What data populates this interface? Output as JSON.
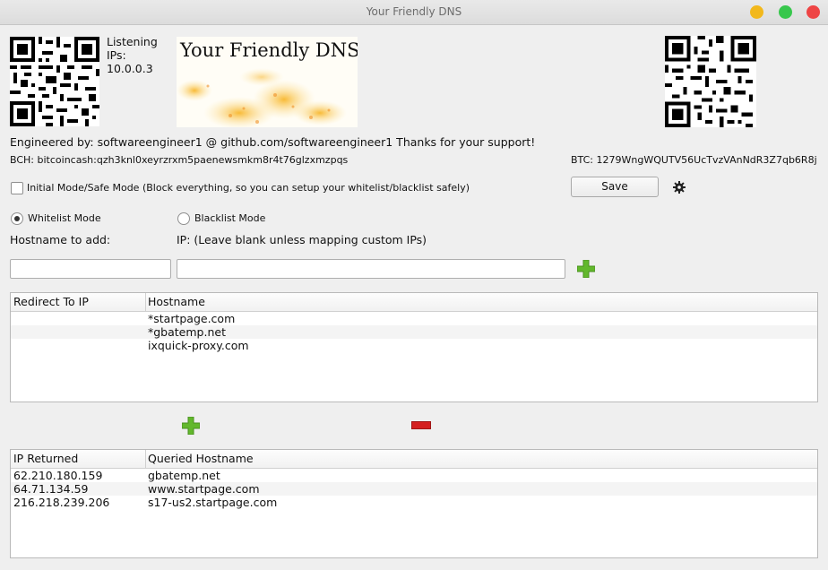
{
  "window": {
    "title": "Your Friendly DNS"
  },
  "listening": {
    "label_line1": "Listening",
    "label_line2": "IPs:",
    "ip": "10.0.0.3"
  },
  "banner": {
    "title": "Your Friendly DNS!"
  },
  "credits": {
    "engineered_by": "Engineered by: softwareengineer1 @ github.com/softwareengineer1 Thanks for your support!",
    "bch": "BCH: bitcoincash:qzh3knl0xeyrzrxm5paenewsmkm8r4t76glzxmzpqs",
    "btc": "BTC: 1279WngWQUTV56UcTvzVAnNdR3Z7qb6R8j"
  },
  "options": {
    "initial_mode_label": "Initial Mode/Safe Mode (Block everything, so you can setup your whitelist/blacklist safely)",
    "initial_mode_checked": false,
    "save_label": "Save",
    "whitelist_label": "Whitelist Mode",
    "blacklist_label": "Blacklist Mode",
    "selected_mode": "whitelist"
  },
  "add_form": {
    "hostname_label": "Hostname to add:",
    "ip_label": "IP: (Leave blank unless mapping custom IPs)",
    "hostname_value": "",
    "ip_value": ""
  },
  "list_table": {
    "columns": [
      "Redirect To IP",
      "Hostname"
    ],
    "rows": [
      [
        "",
        "*startpage.com"
      ],
      [
        "",
        "*gbatemp.net"
      ],
      [
        "",
        "ixquick-proxy.com"
      ]
    ]
  },
  "query_table": {
    "columns": [
      "IP Returned",
      "Queried Hostname"
    ],
    "rows": [
      [
        "62.210.180.159",
        "gbatemp.net"
      ],
      [
        "64.71.134.59",
        "www.startpage.com"
      ],
      [
        "216.218.239.206",
        "s17-us2.startpage.com"
      ]
    ]
  },
  "colors": {
    "add_green": "#62b82c",
    "remove_red": "#d42020",
    "accent": "#333333"
  },
  "icons": {
    "qr_left": "qr-code-icon",
    "qr_right": "qr-code-icon",
    "settings": "gear-icon",
    "add": "plus-icon",
    "remove": "minus-icon"
  }
}
